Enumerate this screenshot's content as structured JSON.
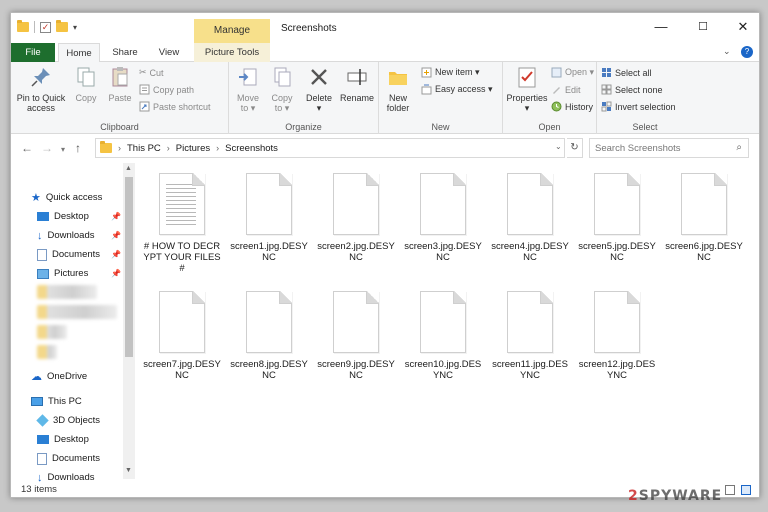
{
  "window": {
    "title": "Screenshots",
    "manage_label": "Manage",
    "controls": {
      "minimize": "—",
      "maximize": "☐",
      "close": "✕"
    }
  },
  "tabs": {
    "file": "File",
    "home": "Home",
    "share": "Share",
    "view": "View",
    "picture_tools": "Picture Tools"
  },
  "ribbon": {
    "clipboard": {
      "label": "Clipboard",
      "pin_line1": "Pin to Quick",
      "pin_line2": "access",
      "copy": "Copy",
      "paste": "Paste",
      "cut": "Cut",
      "copy_path": "Copy path",
      "paste_shortcut": "Paste shortcut"
    },
    "organize": {
      "label": "Organize",
      "move_to": "Move",
      "move_to2": "to ▾",
      "copy_to": "Copy",
      "copy_to2": "to ▾",
      "delete": "Delete",
      "delete2": "▾",
      "rename": "Rename"
    },
    "new": {
      "label": "New",
      "new_folder1": "New",
      "new_folder2": "folder",
      "new_item": "New item ▾",
      "easy_access": "Easy access ▾"
    },
    "open": {
      "label": "Open",
      "properties": "Properties",
      "properties2": "▾",
      "open": "Open ▾",
      "edit": "Edit",
      "history": "History"
    },
    "select": {
      "label": "Select",
      "select_all": "Select all",
      "select_none": "Select none",
      "invert": "Invert selection"
    }
  },
  "address": {
    "crumbs": [
      "This PC",
      "Pictures",
      "Screenshots"
    ],
    "search_placeholder": "Search Screenshots"
  },
  "sidebar": {
    "quick_access": "Quick access",
    "desktop": "Desktop",
    "downloads": "Downloads",
    "documents": "Documents",
    "pictures": "Pictures",
    "onedrive": "OneDrive",
    "this_pc": "This PC",
    "objects3d": "3D Objects",
    "pc_desktop": "Desktop",
    "pc_documents": "Documents",
    "pc_downloads": "Downloads"
  },
  "files": [
    "# HOW TO DECRYPT YOUR FILES #",
    "screen1.jpg.DESYNC",
    "screen2.jpg.DESYNC",
    "screen3.jpg.DESYNC",
    "screen4.jpg.DESYNC",
    "screen5.jpg.DESYNC",
    "screen6.jpg.DESYNC",
    "screen7.jpg.DESYNC",
    "screen8.jpg.DESYNC",
    "screen9.jpg.DESYNC",
    "screen10.jpg.DESYNC",
    "screen11.jpg.DESYNC",
    "screen12.jpg.DESYNC"
  ],
  "status": {
    "count": "13 items"
  },
  "watermark": {
    "prefix": "2",
    "text": "SPYWARE"
  },
  "colors": {
    "file_tab": "#1e6e2e",
    "manage_tab": "#f7e08b",
    "accent": "#1a66c8"
  }
}
